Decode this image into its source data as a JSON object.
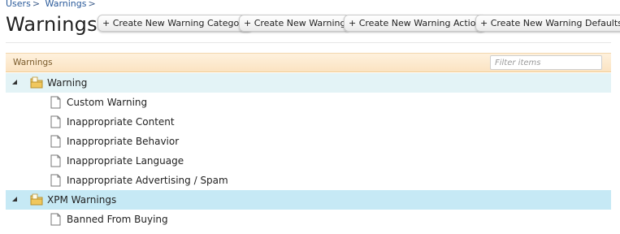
{
  "breadcrumb": {
    "items": [
      "Users",
      "Warnings"
    ],
    "separator": ">"
  },
  "page": {
    "title": "Warnings"
  },
  "toolbar": {
    "create_category": "+ Create New Warning Category",
    "create_warning": "+ Create New Warning",
    "create_action": "+ Create New Warning Action",
    "create_defaults": "+ Create New Warning Defaults"
  },
  "panel": {
    "header": "Warnings",
    "filter_placeholder": "Filter items"
  },
  "categories": [
    {
      "label": "Warning",
      "expanded": true,
      "items": [
        "Custom Warning",
        "Inappropriate Content",
        "Inappropriate Behavior",
        "Inappropriate Language",
        "Inappropriate Advertising / Spam"
      ]
    },
    {
      "label": "XPM Warnings",
      "expanded": true,
      "items": [
        "Banned From Buying"
      ]
    }
  ],
  "icons": {
    "category": "folder-icon",
    "item": "document-icon",
    "toggle": "collapse-triangle-icon"
  },
  "colors": {
    "header_bg": "#fbe6c9",
    "category_row": "#e3f3f6",
    "category_row_selected": "#c6e9f5",
    "link": "#2a5a9a"
  }
}
